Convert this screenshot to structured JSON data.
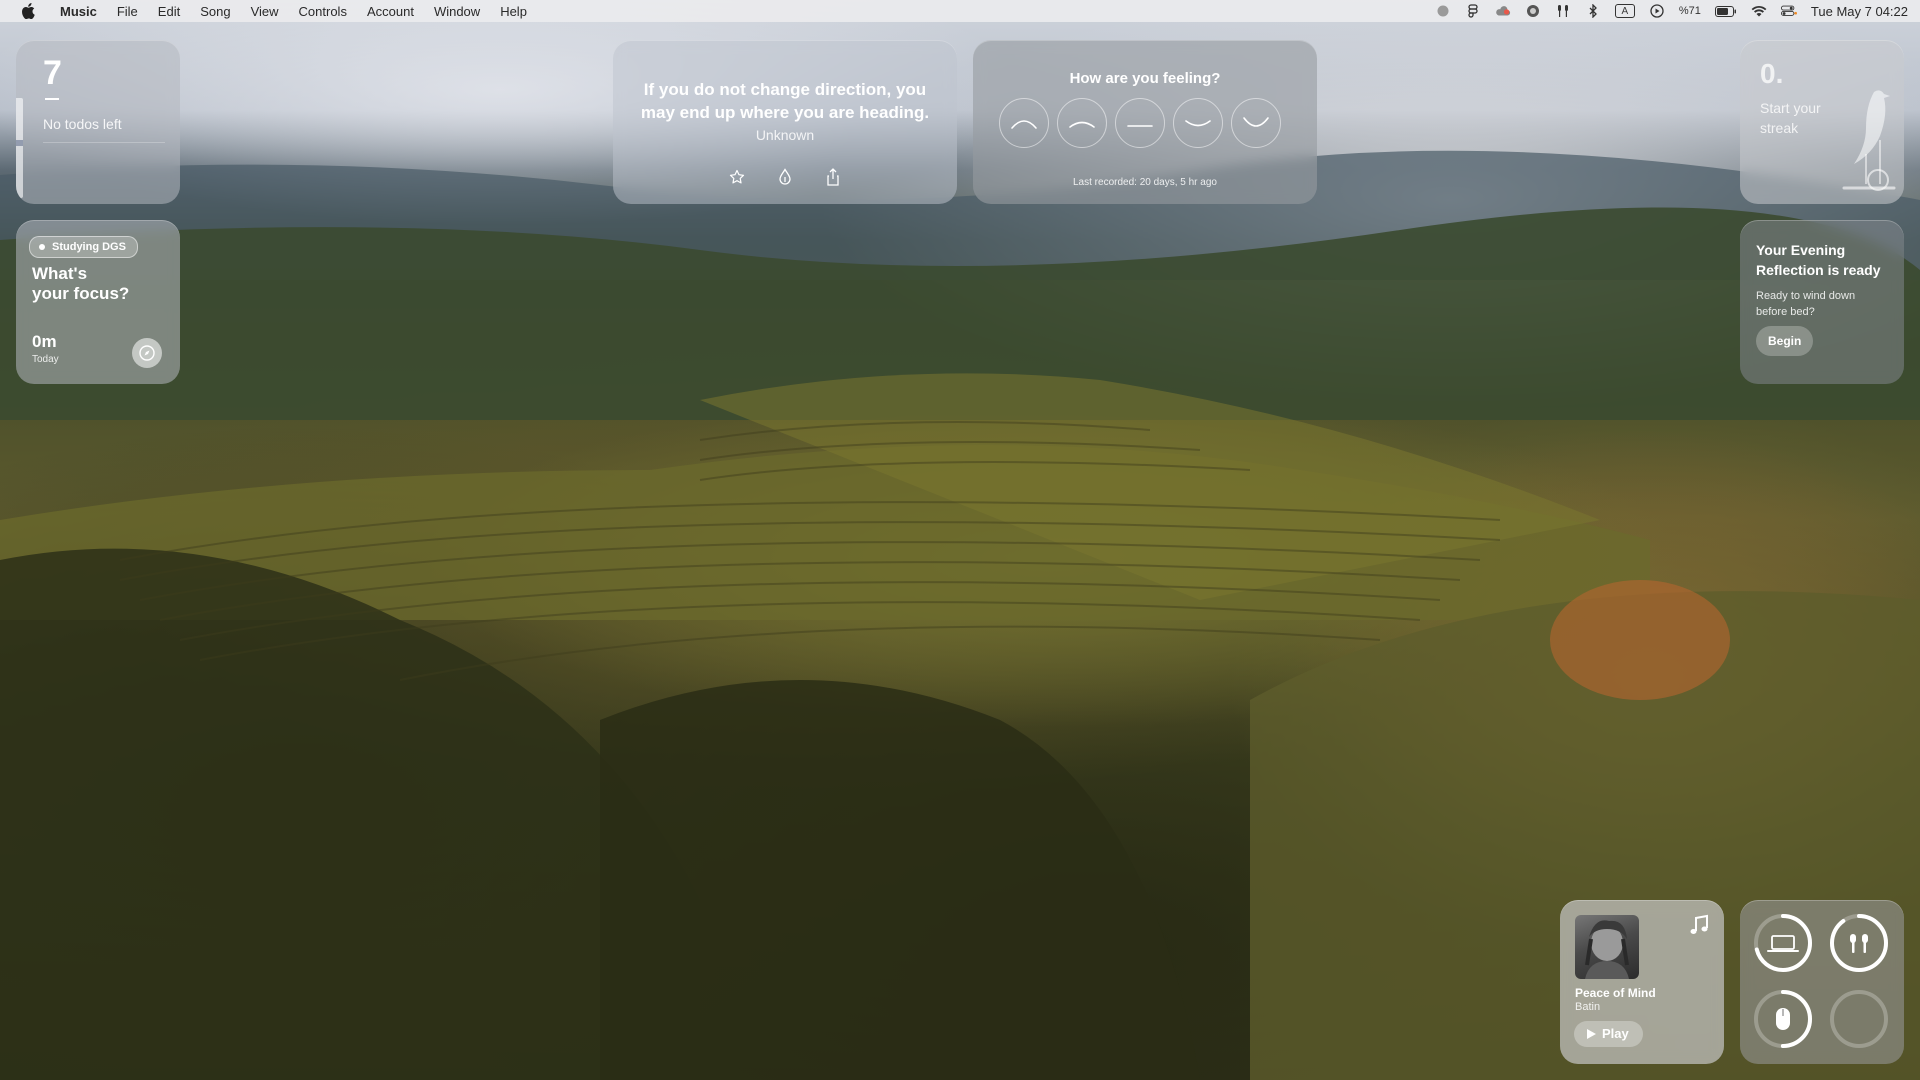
{
  "menubar": {
    "app_name": "Music",
    "menus": [
      "File",
      "Edit",
      "Song",
      "View",
      "Controls",
      "Account",
      "Window",
      "Help"
    ],
    "status_icons": [
      "record-icon",
      "figma-icon",
      "cloud-icon",
      "circle-icon",
      "airpods-icon",
      "bluetooth-icon",
      "input-source-icon",
      "play-circle-icon",
      "battery-icon",
      "wifi-icon",
      "control-center-icon"
    ],
    "battery_label": "%71",
    "input_label": "A",
    "clock": "Tue May 7  04:22"
  },
  "todos": {
    "count": "7",
    "label": "No todos left"
  },
  "focus": {
    "tag": "Studying DGS",
    "question_line1": "What's",
    "question_line2": "your focus?",
    "minutes": "0m",
    "period": "Today"
  },
  "quote": {
    "text": "If you do not change direction, you may end up where you are heading.",
    "author": "Unknown",
    "actions": [
      "star-icon",
      "drop-icon",
      "share-icon"
    ]
  },
  "mood": {
    "title": "How are you feeling?",
    "options": [
      "very-sad-icon",
      "sad-icon",
      "neutral-icon",
      "happy-icon",
      "very-happy-icon"
    ],
    "last_recorded": "Last recorded: 20 days, 5 hr ago"
  },
  "streak": {
    "count": "0.",
    "label": "Start your streak"
  },
  "reflection": {
    "title": "Your Evening Reflection is ready",
    "subtitle": "Ready to wind down before bed?",
    "button": "Begin"
  },
  "music": {
    "song": "Peace of Mind",
    "artist": "Batin",
    "play_label": "Play"
  },
  "batteries": {
    "devices": [
      {
        "name": "laptop-icon",
        "level": 0.71
      },
      {
        "name": "airpods-icon",
        "level": 0.9
      },
      {
        "name": "mouse-icon",
        "level": 0.5
      },
      {
        "name": "empty-slot",
        "level": 0
      }
    ]
  },
  "colors": {
    "menubar_bg": "#ececee",
    "widget_text": "#ffffff"
  }
}
